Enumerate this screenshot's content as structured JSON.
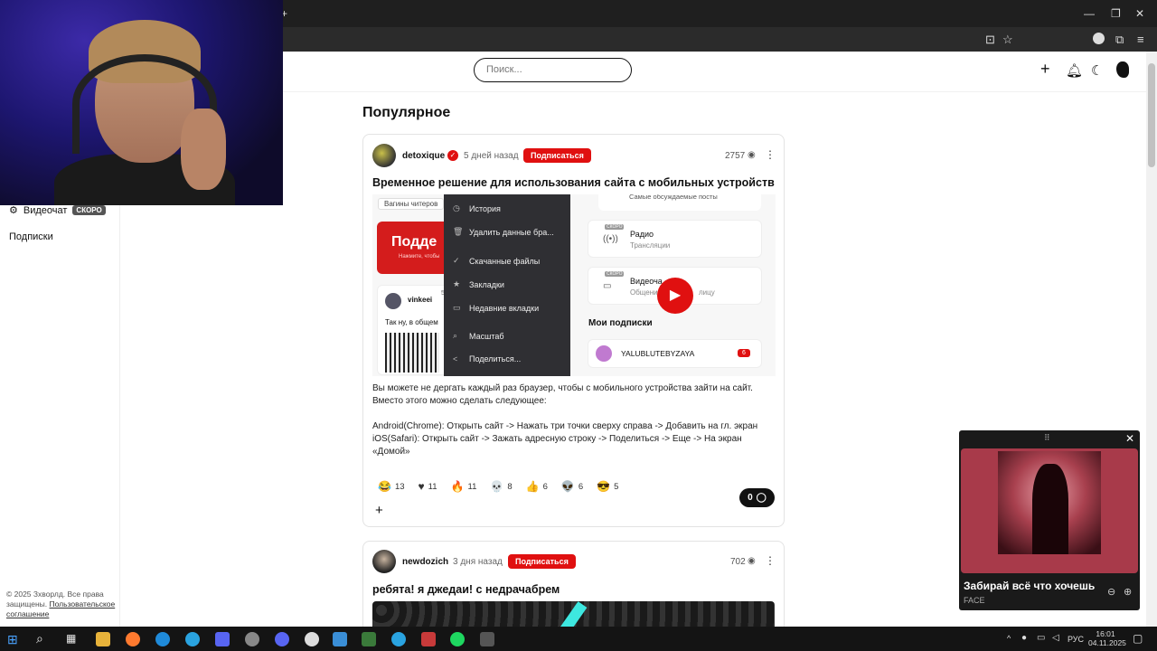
{
  "browser": {
    "window_controls": [
      "—",
      "❐",
      "✕"
    ],
    "tab_plus": "+"
  },
  "sidebar": {
    "videochat_label": "Видеочат",
    "soon_badge": "СКОРО",
    "subscriptions_label": "Подписки",
    "footer_copyright": "© 2025 Зхворлд. Все права защищены.",
    "footer_link": "Пользовательское соглашение"
  },
  "header": {
    "search_placeholder": "Поиск..."
  },
  "main": {
    "section_title": "Популярное",
    "posts": [
      {
        "author": "detoxique",
        "time": "5 дней назад",
        "subscribe_label": "Подписаться",
        "views": "2757",
        "title": "Временное решение для использования сайта с мобильных устройств",
        "body_line1": "Вы можете не дергать каждый раз браузер, чтобы с мобильного устройства зайти на сайт. Вместо этого можно сделать следующее:",
        "body_line2": "Android(Chrome): Открыть сайт -> Нажать три точки сверху справа -> Добавить на гл. экран",
        "body_line3": "iOS(Safari): Открыть сайт -> Зажать адресную строку -> Поделиться -> Еще -> На экран «Домой»",
        "reactions": [
          {
            "icon": "laugh-icon",
            "glyph": "😂",
            "count": "13"
          },
          {
            "icon": "heart-icon",
            "glyph": "♥",
            "count": "11"
          },
          {
            "icon": "fire-icon",
            "glyph": "🔥",
            "count": "11"
          },
          {
            "icon": "skull-icon",
            "glyph": "💀",
            "count": "8"
          },
          {
            "icon": "thumb-icon",
            "glyph": "👍",
            "count": "6"
          },
          {
            "icon": "alien-icon",
            "glyph": "👽",
            "count": "6"
          },
          {
            "icon": "cool-icon",
            "glyph": "😎",
            "count": "5"
          }
        ],
        "comments_count": "0",
        "embed": {
          "top_left_label": "Вагины читеров",
          "banner_text": "Подде",
          "banner_sub": "Нажмите, чтобы",
          "top_right_label": "Самые обсуждаемые посты",
          "radio_title": "Радио",
          "radio_sub": "Трансляции",
          "radio_badge": "СКОРО",
          "video_title": "Видеоча",
          "video_sub": "Общени",
          "video_sub_tail": "лицу",
          "video_badge": "СКОРО",
          "my_subs_title": "Мои подписки",
          "sub_name": "YALUBLUTEBYZAYA",
          "sub_count": "6",
          "user_name": "vinkeei",
          "user_num": "5",
          "user_text": "Так ну, в общем",
          "context_menu": [
            {
              "icon": "history-icon",
              "glyph": "◷",
              "label": "История"
            },
            {
              "icon": "trash-icon",
              "glyph": "🗑",
              "label": "Удалить данные бра..."
            },
            {
              "icon": "download-icon",
              "glyph": "✓",
              "label": "Скачанные файлы"
            },
            {
              "icon": "star-icon",
              "glyph": "★",
              "label": "Закладки"
            },
            {
              "icon": "tabs-icon",
              "glyph": "▭",
              "label": "Недавние вкладки"
            },
            {
              "icon": "zoom-icon",
              "glyph": "⌕",
              "label": "Масштаб"
            },
            {
              "icon": "share-icon",
              "glyph": "<",
              "label": "Поделиться..."
            }
          ]
        }
      },
      {
        "author": "newdozich",
        "time": "3 дня назад",
        "subscribe_label": "Подписаться",
        "views": "702",
        "title": "ребята! я джедаи! с недрачабрем"
      }
    ]
  },
  "miniplayer": {
    "track_title": "Забирай всё что хочешь",
    "artist": "FACE"
  },
  "taskbar": {
    "lang": "РУС",
    "time": "16:01",
    "date": "04.11.2025"
  },
  "colors": {
    "accent_red": "#e01010",
    "menu_bg": "#2f2f33"
  }
}
